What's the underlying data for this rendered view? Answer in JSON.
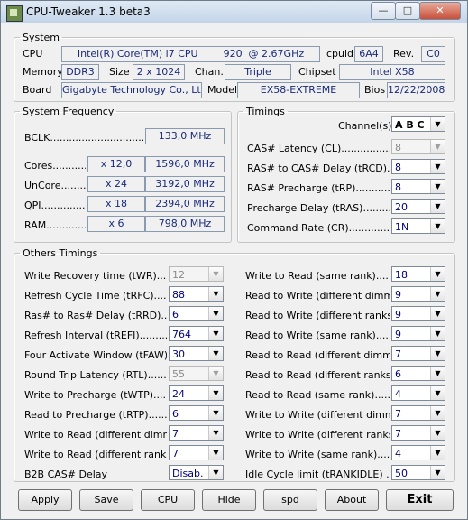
{
  "window": {
    "title": "CPU-Tweaker 1.3 beta3",
    "controls": [
      "—",
      "□",
      "✕"
    ]
  },
  "system": {
    "legend": "System",
    "cpu_label": "CPU",
    "cpu_value": "Intel(R) Core(TM) i7 CPU        920  @ 2.67GHz",
    "cpuid_label": "cpuid",
    "cpuid_value": "6A4",
    "rev_label": "Rev.",
    "rev_value": "C0",
    "memory_label": "Memory",
    "memory_value": "DDR3",
    "size_label": "Size",
    "size_value": "2 x 1024",
    "chan_label": "Chan.",
    "chan_value": "Triple",
    "chipset_label": "Chipset",
    "chipset_value": "Intel X58",
    "board_label": "Board",
    "board_value": "Gigabyte Technology Co., Ltd.",
    "model_label": "Model",
    "model_value": "EX58-EXTREME",
    "bios_label": "Bios",
    "bios_value": "12/22/2008"
  },
  "frequency": {
    "legend": "System Frequency",
    "bclk_label": "BCLK......................................",
    "bclk_value": "133,0 MHz",
    "rows": [
      {
        "label": "Cores...............",
        "mult": "x 12,0",
        "freq": "1596,0 MHz"
      },
      {
        "label": "UnCore...............",
        "mult": "x 24",
        "freq": "3192,0 MHz"
      },
      {
        "label": "QPI...............",
        "mult": "x 18",
        "freq": "2394,0 MHz"
      },
      {
        "label": "RAM...............",
        "mult": "x 6",
        "freq": "798,0 MHz"
      }
    ]
  },
  "timings": {
    "legend": "Timings",
    "channels_label": "Channel(s)",
    "channels_value": "A B C",
    "rows": [
      {
        "label": "CAS# Latency (CL)....................",
        "value": "8",
        "disabled": true
      },
      {
        "label": "RAS# to CAS# Delay (tRCD).........",
        "value": "8",
        "disabled": false
      },
      {
        "label": "RAS# Precharge (tRP)..................",
        "value": "8",
        "disabled": false
      },
      {
        "label": "Precharge Delay (tRAS)..............",
        "value": "20",
        "disabled": false
      },
      {
        "label": "Command Rate (CR).......................",
        "value": "1N",
        "disabled": false
      }
    ]
  },
  "others": {
    "legend": "Others Timings",
    "left": [
      {
        "label": "Write Recovery time (tWR)..........",
        "value": "12",
        "disabled": true
      },
      {
        "label": "Refresh Cycle Time (tRFC).........",
        "value": "88",
        "disabled": false
      },
      {
        "label": "Ras# to Ras# Delay (tRRD)........",
        "value": "6",
        "disabled": false
      },
      {
        "label": "Refresh Interval (tREFI)............",
        "value": "764",
        "disabled": false
      },
      {
        "label": "Four Activate Window (tFAW)......",
        "value": "30",
        "disabled": false
      },
      {
        "label": "Round Trip Latency (RTL)..........",
        "value": "55",
        "disabled": true
      },
      {
        "label": "Write to Precharge (tWTP)..........",
        "value": "24",
        "disabled": false
      },
      {
        "label": "Read to Precharge (tRTP)............",
        "value": "6",
        "disabled": false
      },
      {
        "label": "Write to Read (different dimms)...",
        "value": "7",
        "disabled": false
      },
      {
        "label": "Write to Read (different ranks)....",
        "value": "7",
        "disabled": false
      },
      {
        "label": "B2B CAS# Delay",
        "value": "Disab.",
        "disabled": false
      }
    ],
    "right": [
      {
        "label": "Write to Read (same rank).............",
        "value": "18",
        "disabled": false
      },
      {
        "label": "Read to Write (different dimms).....",
        "value": "9",
        "disabled": false
      },
      {
        "label": "Read to Write (different ranks)......",
        "value": "9",
        "disabled": false
      },
      {
        "label": "Read to Write (same rank).............",
        "value": "9",
        "disabled": false
      },
      {
        "label": "Read to Read (different dimms)......",
        "value": "7",
        "disabled": false
      },
      {
        "label": "Read to Read (different ranks).......",
        "value": "6",
        "disabled": false
      },
      {
        "label": "Read to Read (same rank).............",
        "value": "4",
        "disabled": false
      },
      {
        "label": "Write to Write (different dimms)....",
        "value": "7",
        "disabled": false
      },
      {
        "label": "Write to Write (different ranks).....",
        "value": "7",
        "disabled": false
      },
      {
        "label": "Write to Write (same rank)............",
        "value": "4",
        "disabled": false
      },
      {
        "label": "Idle Cycle limit (tRANKIDLE) .........",
        "value": "50",
        "disabled": false
      }
    ]
  },
  "buttons": [
    "Apply",
    "Save",
    "CPU",
    "Hide",
    "spd",
    "About",
    "Exit"
  ]
}
